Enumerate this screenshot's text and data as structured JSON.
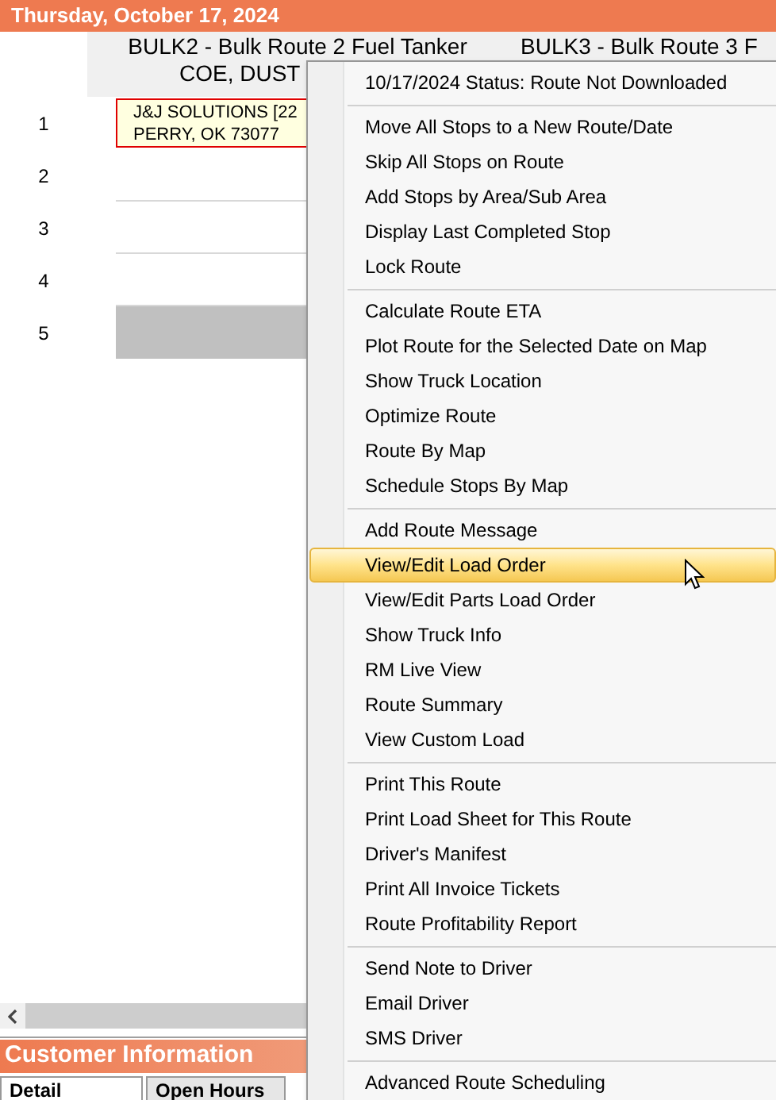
{
  "date_bar": {
    "title": "Thursday, October 17, 2024"
  },
  "route_columns": [
    {
      "title": "BULK2 - Bulk Route 2 Fuel Tanker",
      "driver": "COE, DUST"
    },
    {
      "title": "BULK3 - Bulk Route 3 F"
    }
  ],
  "rows": [
    {
      "number": "1",
      "kind": "stop",
      "customer": "J&J SOLUTIONS [22",
      "address": "PERRY, OK 73077"
    },
    {
      "number": "2",
      "kind": "empty"
    },
    {
      "number": "3",
      "kind": "empty"
    },
    {
      "number": "4",
      "kind": "empty"
    },
    {
      "number": "5",
      "kind": "blocked"
    }
  ],
  "customer_panel": {
    "title": "Customer Information",
    "tabs": [
      {
        "label": "Detail",
        "selected": true
      },
      {
        "label": "Open Hours",
        "selected": false
      }
    ]
  },
  "context_menu": {
    "items": [
      {
        "kind": "item",
        "label": "10/17/2024 Status: Route Not Downloaded",
        "selected": false
      },
      {
        "kind": "separator"
      },
      {
        "kind": "item",
        "label": "Move All Stops to a New Route/Date",
        "selected": false
      },
      {
        "kind": "item",
        "label": "Skip All Stops on Route",
        "selected": false
      },
      {
        "kind": "item",
        "label": "Add Stops by Area/Sub Area",
        "selected": false
      },
      {
        "kind": "item",
        "label": "Display Last Completed Stop",
        "selected": false
      },
      {
        "kind": "item",
        "label": "Lock Route",
        "selected": false
      },
      {
        "kind": "separator"
      },
      {
        "kind": "item",
        "label": "Calculate Route ETA",
        "selected": false
      },
      {
        "kind": "item",
        "label": "Plot Route for the Selected Date on Map",
        "selected": false
      },
      {
        "kind": "item",
        "label": "Show Truck Location",
        "selected": false
      },
      {
        "kind": "item",
        "label": "Optimize Route",
        "selected": false
      },
      {
        "kind": "item",
        "label": "Route By Map",
        "selected": false
      },
      {
        "kind": "item",
        "label": "Schedule Stops By Map",
        "selected": false
      },
      {
        "kind": "separator"
      },
      {
        "kind": "item",
        "label": "Add Route Message",
        "selected": false
      },
      {
        "kind": "item",
        "label": "View/Edit Load Order",
        "selected": true
      },
      {
        "kind": "item",
        "label": "View/Edit Parts Load Order",
        "selected": false
      },
      {
        "kind": "item",
        "label": "Show Truck Info",
        "selected": false
      },
      {
        "kind": "item",
        "label": "RM Live View",
        "selected": false
      },
      {
        "kind": "item",
        "label": "Route Summary",
        "selected": false
      },
      {
        "kind": "item",
        "label": "View Custom Load",
        "selected": false
      },
      {
        "kind": "separator"
      },
      {
        "kind": "item",
        "label": "Print This Route",
        "selected": false
      },
      {
        "kind": "item",
        "label": "Print Load Sheet for This Route",
        "selected": false
      },
      {
        "kind": "item",
        "label": "Driver's Manifest",
        "selected": false
      },
      {
        "kind": "item",
        "label": "Print All Invoice Tickets",
        "selected": false
      },
      {
        "kind": "item",
        "label": "Route Profitability Report",
        "selected": false
      },
      {
        "kind": "separator"
      },
      {
        "kind": "item",
        "label": "Send Note to Driver",
        "selected": false
      },
      {
        "kind": "item",
        "label": "Email Driver",
        "selected": false
      },
      {
        "kind": "item",
        "label": "SMS Driver",
        "selected": false
      },
      {
        "kind": "separator"
      },
      {
        "kind": "item",
        "label": "Advanced Route Scheduling",
        "selected": false
      }
    ]
  }
}
